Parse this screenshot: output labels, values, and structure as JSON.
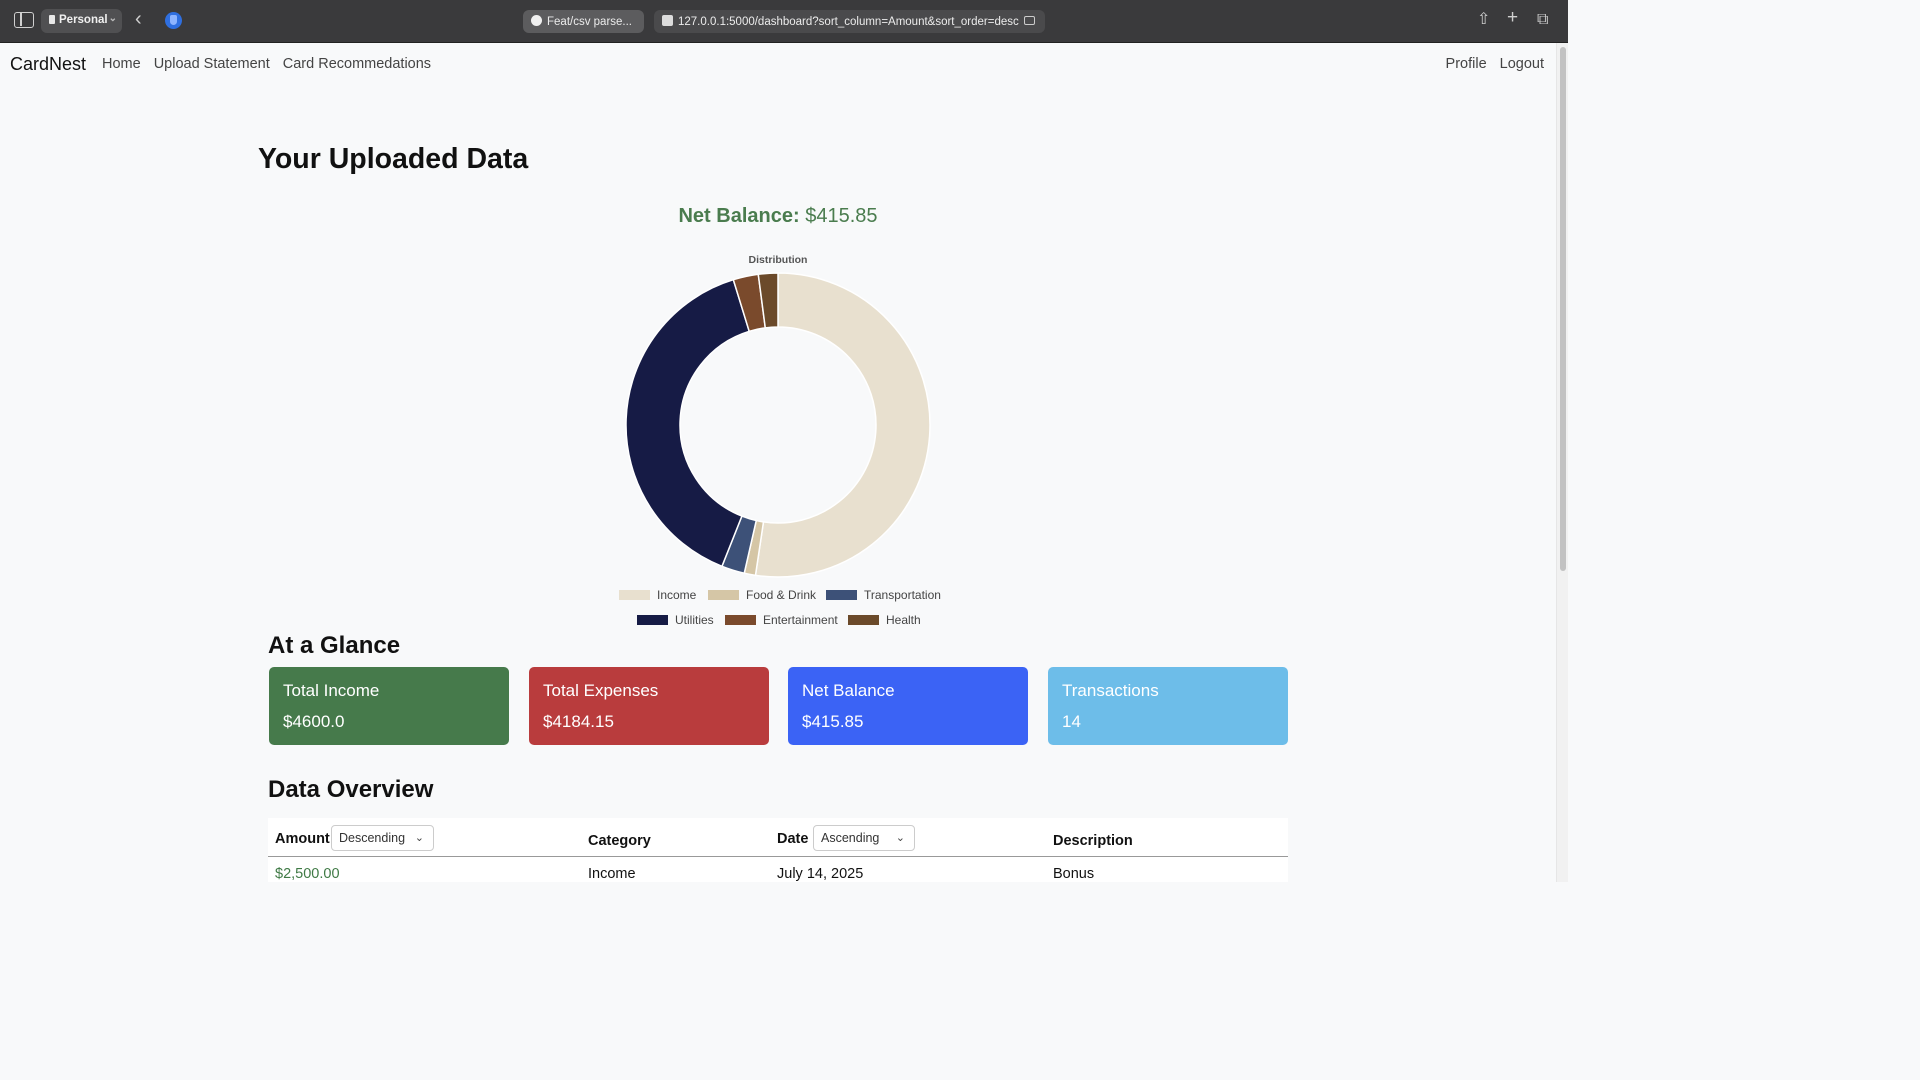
{
  "browser": {
    "profile": "Personal",
    "tabs": [
      {
        "label": "Feat/csv parse..."
      },
      {
        "label": "127.0.0.1:5000/dashboard?sort_column=Amount&sort_order=desc"
      }
    ]
  },
  "nav": {
    "brand": "CardNest",
    "left": [
      "Home",
      "Upload Statement",
      "Card Recommedations"
    ],
    "right": [
      "Profile",
      "Logout"
    ]
  },
  "page": {
    "title": "Your Uploaded Data",
    "net_label": "Net Balance:",
    "net_value": "$415.85"
  },
  "chart_data": {
    "type": "doughnut",
    "title": "Distribution",
    "labels": [
      "Income",
      "Food & Drink",
      "Transportation",
      "Utilities",
      "Entertainment",
      "Health"
    ],
    "values": [
      4600,
      105,
      215,
      3447.15,
      235,
      182
    ],
    "colors": [
      "#e8e0cf",
      "#d5c6a6",
      "#3d5178",
      "#161b45",
      "#7a4a2c",
      "#6b4a2a"
    ],
    "legend_position": "bottom"
  },
  "glance": {
    "title": "At a Glance",
    "cards": [
      {
        "title": "Total Income",
        "value": "$4600.0",
        "color": "#467a4b"
      },
      {
        "title": "Total Expenses",
        "value": "$4184.15",
        "color": "#b93c3d"
      },
      {
        "title": "Net Balance",
        "value": "$415.85",
        "color": "#3b63f5"
      },
      {
        "title": "Transactions",
        "value": "14",
        "color": "#6dbde9"
      }
    ]
  },
  "overview": {
    "title": "Data Overview",
    "headers": {
      "amount": "Amount",
      "category": "Category",
      "date": "Date",
      "description": "Description"
    },
    "amount_sort": "Descending",
    "date_sort": "Ascending",
    "rows": [
      {
        "amount": "$2,500.00",
        "category": "Income",
        "date": "July 14, 2025",
        "description": "Bonus"
      }
    ]
  }
}
